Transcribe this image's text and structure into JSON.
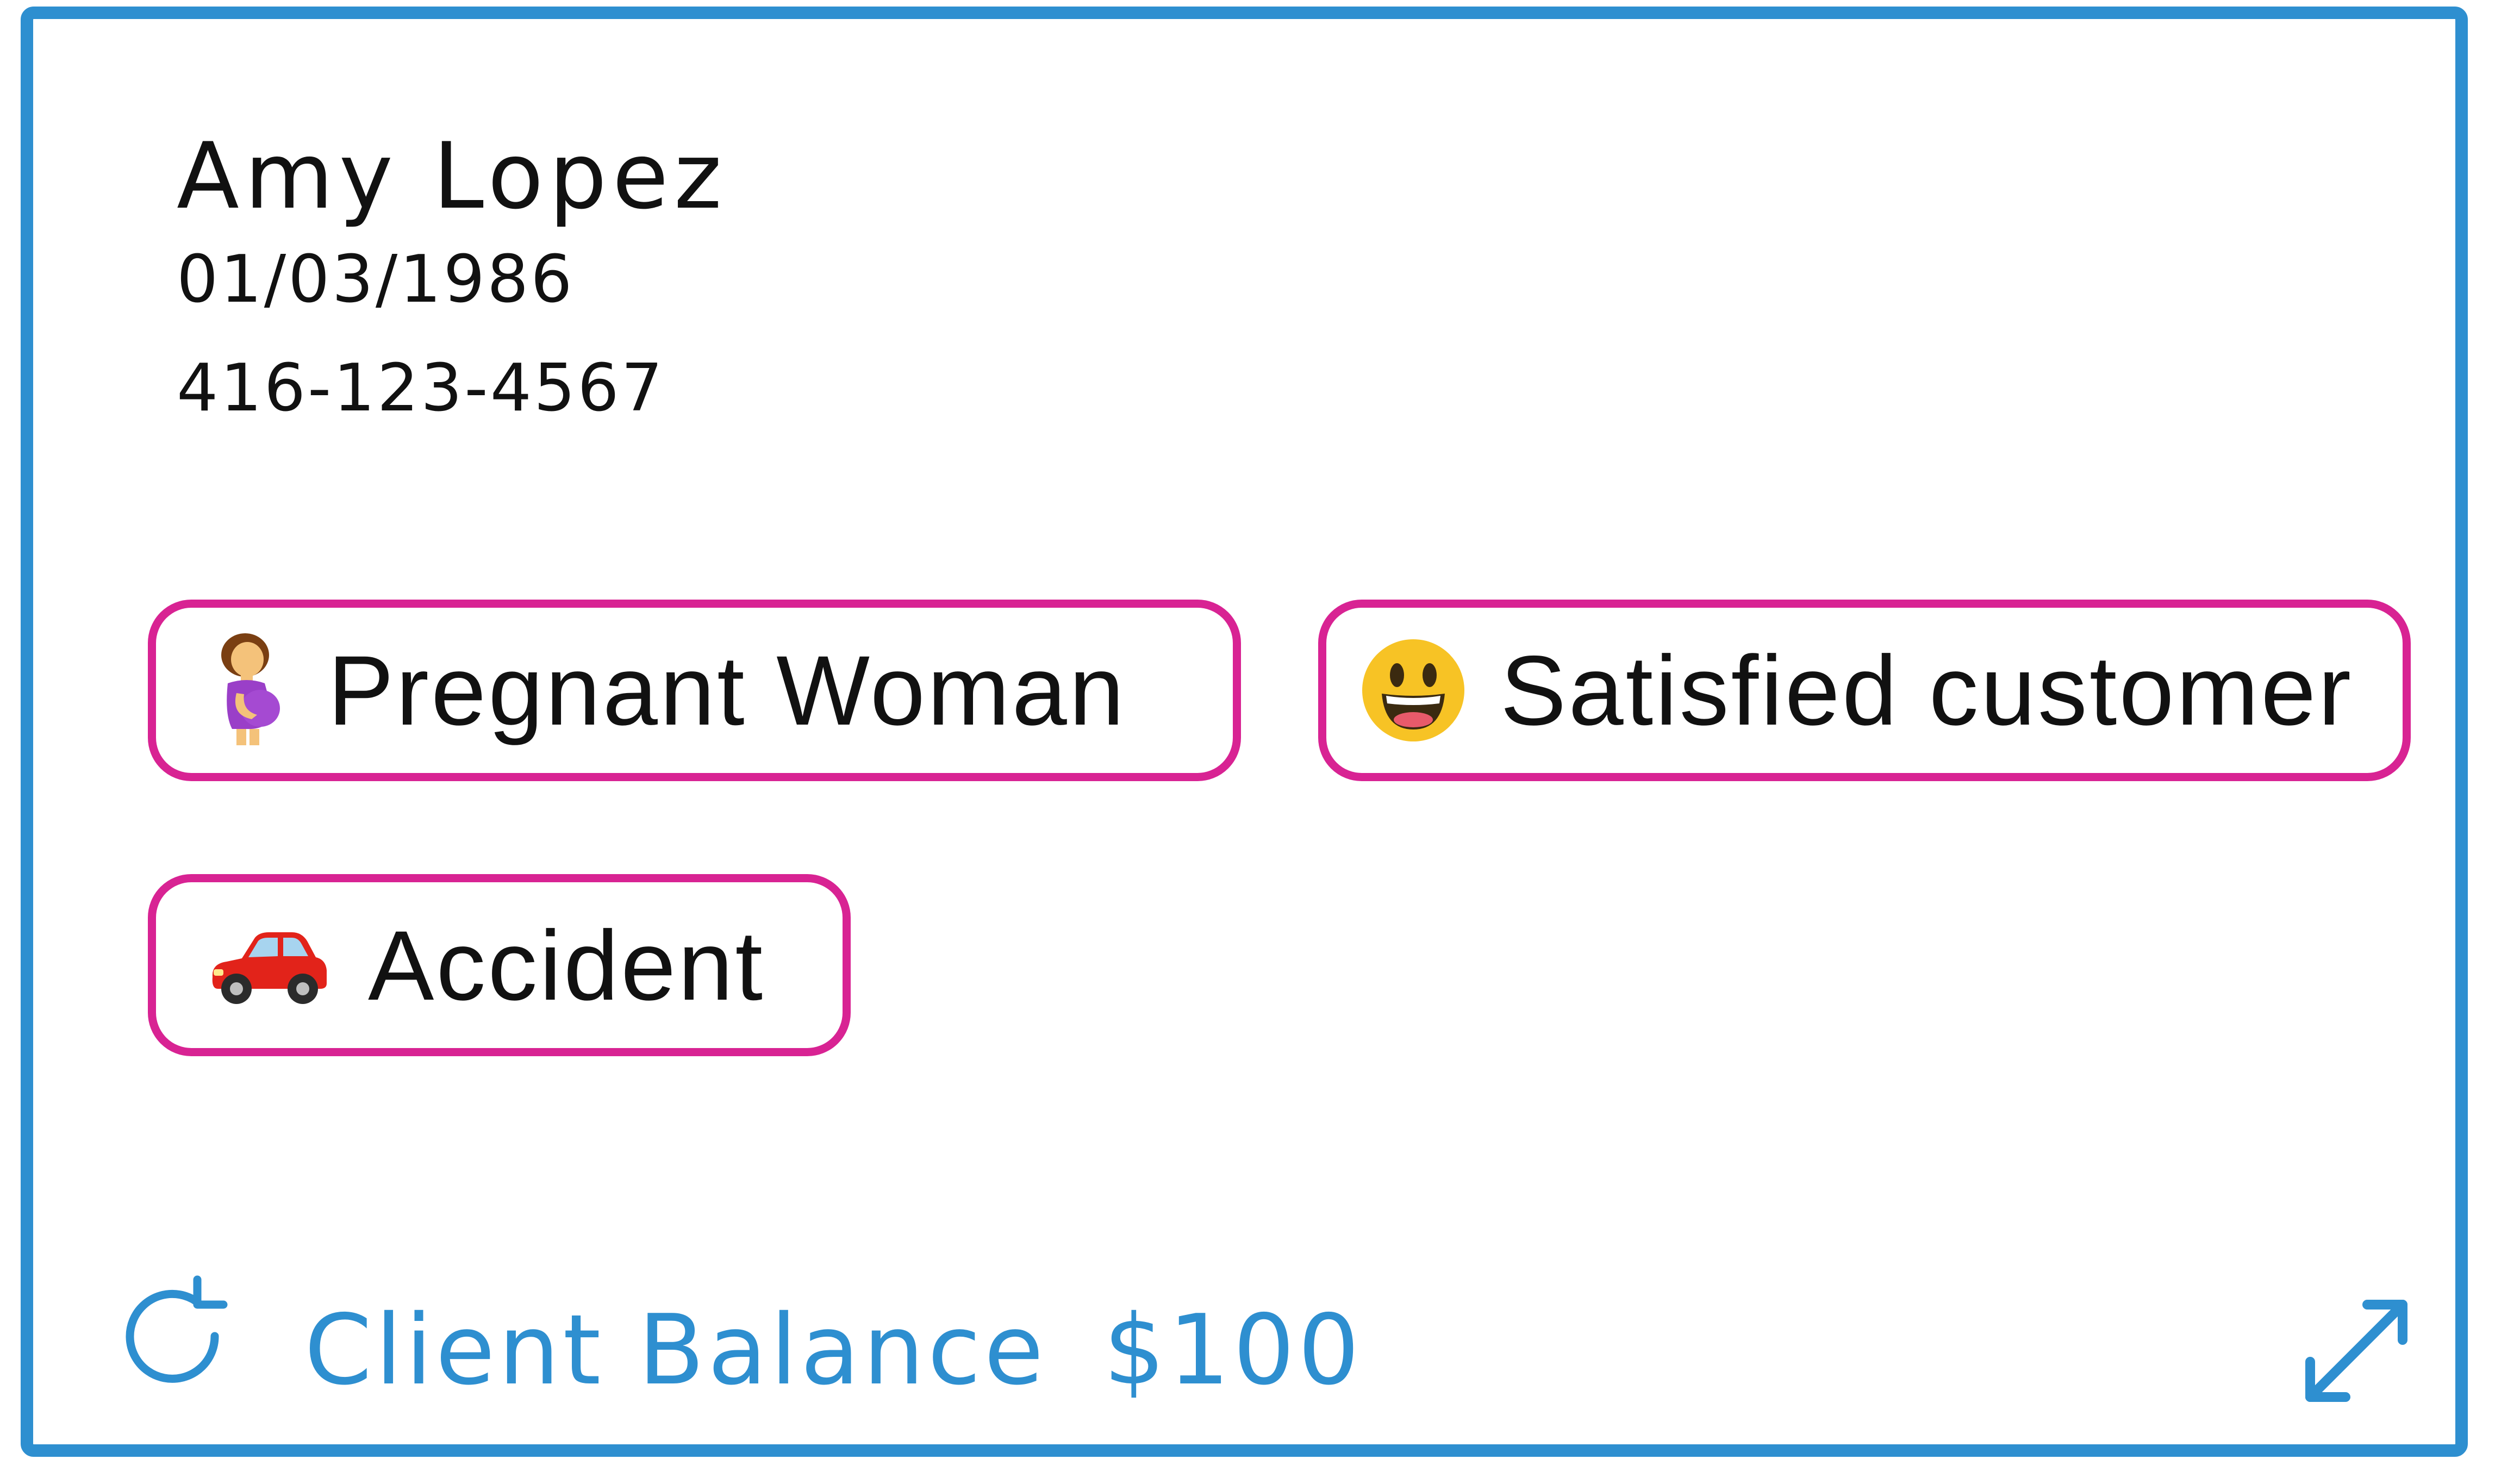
{
  "client": {
    "name": "Amy Lopez",
    "dob": "01/03/1986",
    "phone": "416-123-4567"
  },
  "tags": [
    {
      "label": "Pregnant Woman",
      "icon": "pregnant-woman-icon"
    },
    {
      "label": "Satisfied customer",
      "icon": "smiley-face-icon"
    },
    {
      "label": "Accident",
      "icon": "red-car-icon"
    }
  ],
  "footer": {
    "balance_label": "Client Balance",
    "balance_value": "$100",
    "refresh_icon": "refresh-icon",
    "expand_icon": "expand-icon"
  },
  "colors": {
    "accent": "#2e8fd0",
    "tag_border": "#d82393",
    "text": "#111111"
  }
}
